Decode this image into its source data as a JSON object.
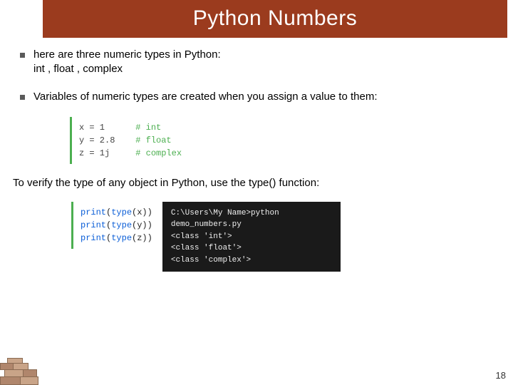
{
  "title": "Python Numbers",
  "bullets": [
    {
      "line1": "here are three numeric types in Python:",
      "line2": "int , float , complex"
    },
    {
      "line1": "Variables of numeric types are created when you assign a value to them:"
    }
  ],
  "code1": {
    "l1a": "x = 1      ",
    "l1b": "# int",
    "l2a": "y = 2.8    ",
    "l2b": "# float",
    "l3a": "z = 1j     ",
    "l3b": "# complex"
  },
  "verify": "To verify the type of any object in Python, use the type() function:",
  "code2": {
    "kw": "print",
    "fn": "type",
    "l1": "(x))",
    "l2": "(y))",
    "l3": "(z))"
  },
  "terminal": {
    "l1": "C:\\Users\\My Name>python demo_numbers.py",
    "l2": "<class 'int'>",
    "l3": "<class 'float'>",
    "l4": "<class 'complex'>"
  },
  "pageNumber": "18"
}
